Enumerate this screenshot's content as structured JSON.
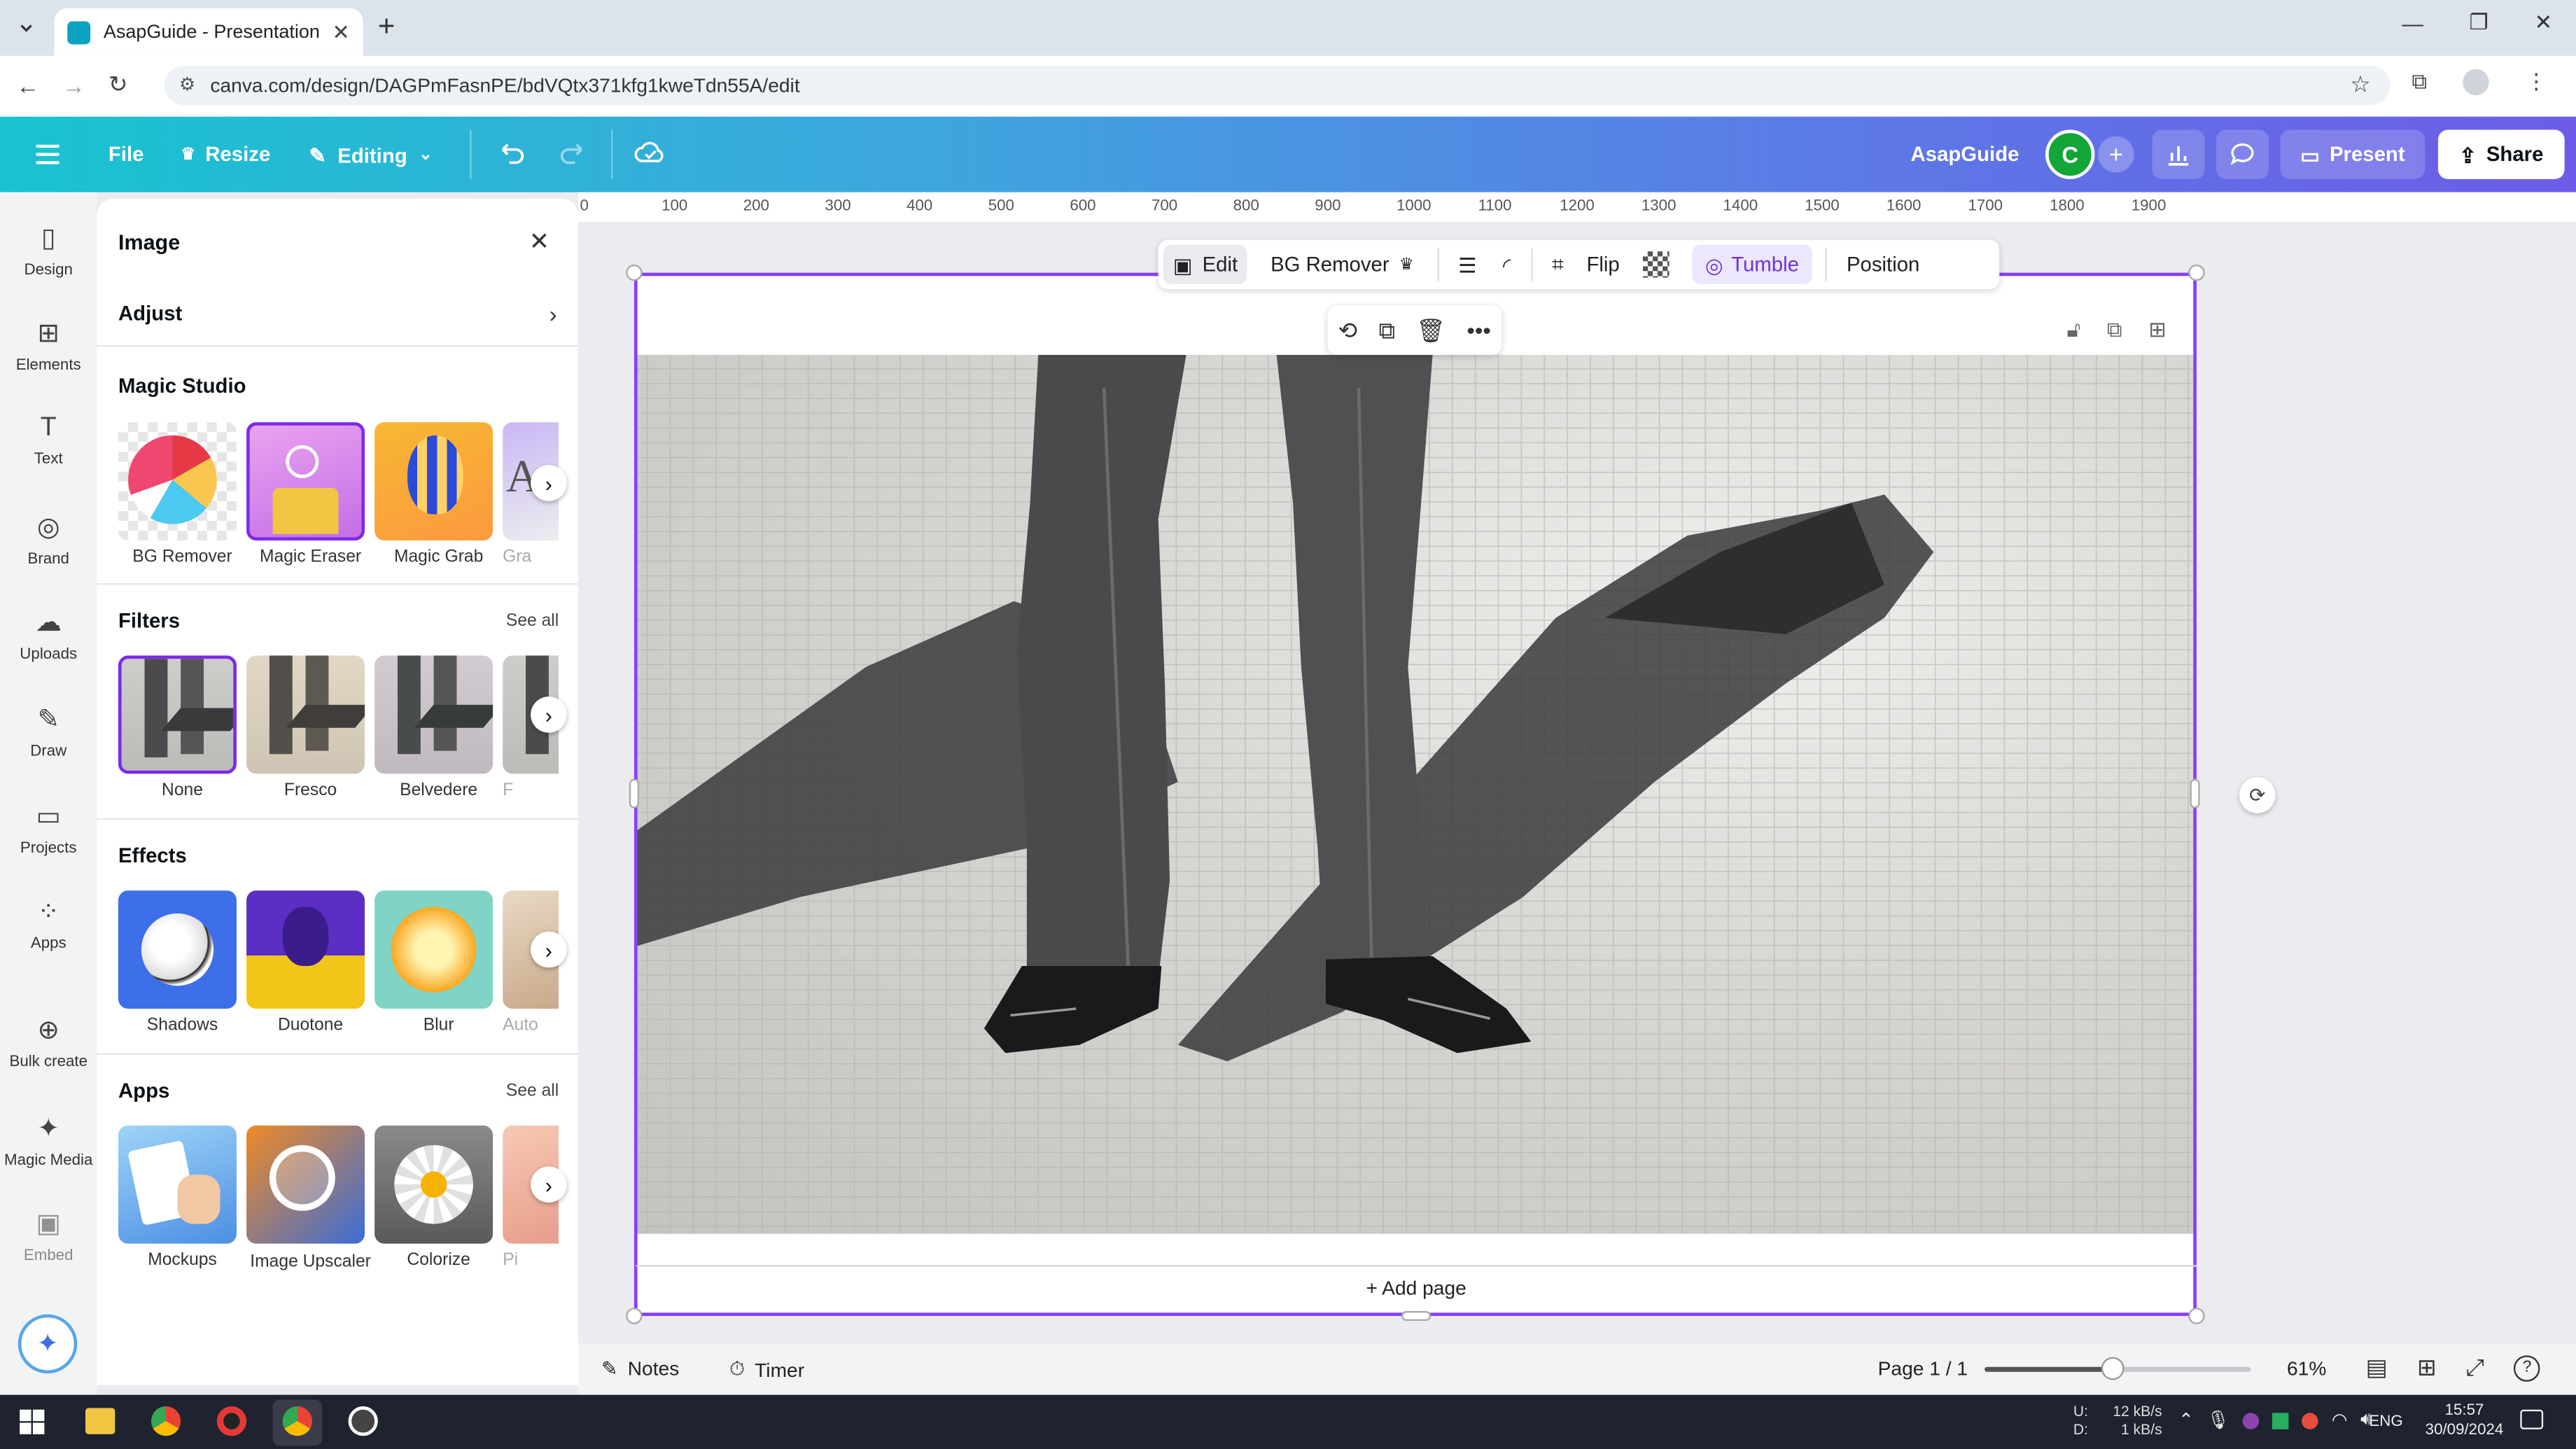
{
  "browser": {
    "tab_title": "AsapGuide - Presentation",
    "url": "canva.com/design/DAGPmFasnPE/bdVQtx371kfg1kweTdn55A/edit"
  },
  "header": {
    "file": "File",
    "resize": "Resize",
    "editing": "Editing",
    "design_name": "AsapGuide",
    "avatar_letter": "C",
    "present": "Present",
    "share": "Share"
  },
  "rail": {
    "items": [
      {
        "label": "Design",
        "icon": "design-icon"
      },
      {
        "label": "Elements",
        "icon": "elements-icon"
      },
      {
        "label": "Text",
        "icon": "text-icon"
      },
      {
        "label": "Brand",
        "icon": "brand-icon"
      },
      {
        "label": "Uploads",
        "icon": "uploads-icon"
      },
      {
        "label": "Draw",
        "icon": "draw-icon"
      },
      {
        "label": "Projects",
        "icon": "projects-icon"
      },
      {
        "label": "Apps",
        "icon": "apps-icon"
      },
      {
        "label": "Bulk create",
        "icon": "bulk-create-icon"
      },
      {
        "label": "Magic Media",
        "icon": "magic-media-icon"
      },
      {
        "label": "Embed",
        "icon": "embed-icon"
      }
    ]
  },
  "panel": {
    "title": "Image",
    "adjust": "Adjust",
    "magic_studio": {
      "heading": "Magic Studio",
      "items": [
        "BG Remover",
        "Magic Eraser",
        "Magic Grab",
        "Gra"
      ]
    },
    "filters": {
      "heading": "Filters",
      "see_all": "See all",
      "items": [
        "None",
        "Fresco",
        "Belvedere",
        "F"
      ]
    },
    "effects": {
      "heading": "Effects",
      "items": [
        "Shadows",
        "Duotone",
        "Blur",
        "Auto"
      ]
    },
    "apps": {
      "heading": "Apps",
      "see_all": "See all",
      "items": [
        "Mockups",
        "Image Upscaler",
        "Colorize",
        "Pi"
      ]
    }
  },
  "ruler": {
    "ticks": [
      "0",
      "100",
      "200",
      "300",
      "400",
      "500",
      "600",
      "700",
      "800",
      "900",
      "1000",
      "1100",
      "1200",
      "1300",
      "1400",
      "1500",
      "1600",
      "1700",
      "1800",
      "1900"
    ]
  },
  "context_toolbar": {
    "edit": "Edit",
    "bg_remover": "BG Remover",
    "flip": "Flip",
    "tumble": "Tumble",
    "position": "Position"
  },
  "canvas": {
    "add_page": "+ Add page"
  },
  "bottombar": {
    "notes": "Notes",
    "timer": "Timer",
    "page": "Page 1 / 1",
    "zoom": "61%",
    "zoom_level": 0.48
  },
  "taskbar": {
    "net_up_label": "U:",
    "net_down_label": "D:",
    "net_up": "12 kB/s",
    "net_down": "1 kB/s",
    "lang": "ENG",
    "time": "15:57",
    "date": "30/09/2024"
  },
  "colors": {
    "accent_purple": "#8b3dff",
    "selection": "#7d2ae8",
    "avatar_green": "#13a538"
  }
}
